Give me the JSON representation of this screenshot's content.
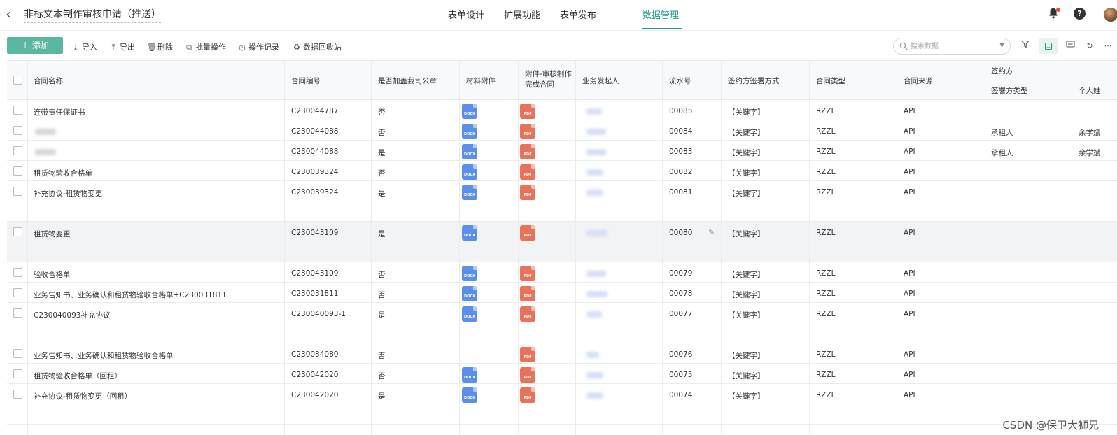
{
  "topbar": {
    "back_icon": "chevron-left-icon",
    "title": "非标文本制作审核申请（推送）",
    "tabs": [
      {
        "label": "表单设计"
      },
      {
        "label": "扩展功能"
      },
      {
        "label": "表单发布"
      },
      {
        "label": "数据管理",
        "active": true
      }
    ],
    "accent_color": "#1e9b8a"
  },
  "toolbar": {
    "add_label": "添加",
    "actions": [
      {
        "label": "导入",
        "icon": "import-icon"
      },
      {
        "label": "导出",
        "icon": "export-icon"
      },
      {
        "label": "删除",
        "icon": "trash-icon"
      },
      {
        "label": "批量操作",
        "icon": "batch-icon"
      },
      {
        "label": "操作记录",
        "icon": "history-icon"
      },
      {
        "label": "数据回收站",
        "icon": "recycle-icon"
      }
    ],
    "search_placeholder": "搜索数据",
    "add_color": "#5bb79f"
  },
  "table": {
    "columns": [
      {
        "label": "合同名称"
      },
      {
        "label": "合同编号"
      },
      {
        "label": "是否加盖我司公章"
      },
      {
        "label": "材料附件"
      },
      {
        "label": "附件-审核制作完成合同"
      },
      {
        "label": "业务发起人"
      },
      {
        "label": "流水号"
      },
      {
        "label": "签约方签署方式"
      },
      {
        "label": "合同类型"
      },
      {
        "label": "合同来源"
      }
    ],
    "group_header": "签约方",
    "sub_columns": [
      {
        "label": "签署方类型"
      },
      {
        "label": "个人姓"
      }
    ],
    "rows": [
      {
        "name": "连带责任保证书",
        "code": "C230044787",
        "seal": "否",
        "docx": true,
        "pdf": true,
        "serial": "00085",
        "method": "【关键字】",
        "type": "RZZL",
        "source": "API",
        "party_type": "",
        "person": ""
      },
      {
        "name": "",
        "code": "C230044088",
        "seal": "否",
        "docx": true,
        "pdf": true,
        "serial": "00084",
        "method": "【关键字】",
        "type": "RZZL",
        "source": "API",
        "party_type": "承租人",
        "person": "余学斌"
      },
      {
        "name": "",
        "code": "C230044088",
        "seal": "是",
        "docx": true,
        "pdf": true,
        "serial": "00083",
        "method": "【关键字】",
        "type": "RZZL",
        "source": "API",
        "party_type": "承租人",
        "person": "余学斌"
      },
      {
        "name": "租赁物验收合格单",
        "code": "C230039324",
        "seal": "否",
        "docx": true,
        "pdf": true,
        "serial": "00082",
        "method": "【关键字】",
        "type": "RZZL",
        "source": "API",
        "party_type": "",
        "person": ""
      },
      {
        "name": "补充协议-租赁物变更",
        "code": "C230039324",
        "seal": "是",
        "docx": true,
        "pdf": true,
        "serial": "00081",
        "method": "【关键字】",
        "type": "RZZL",
        "source": "API",
        "party_type": "",
        "person": ""
      },
      {
        "name": "租赁物变更",
        "code": "C230043109",
        "seal": "是",
        "docx": true,
        "pdf": true,
        "serial": "00080",
        "method": "【关键字】",
        "type": "RZZL",
        "source": "API",
        "party_type": "",
        "person": ""
      },
      {
        "name": "验收合格单",
        "code": "C230043109",
        "seal": "否",
        "docx": true,
        "pdf": true,
        "serial": "00079",
        "method": "【关键字】",
        "type": "RZZL",
        "source": "API",
        "party_type": "",
        "person": ""
      },
      {
        "name": "业务告知书、业务确认和租赁物验收合格单+C230031811",
        "code": "C230031811",
        "seal": "否",
        "docx": true,
        "pdf": true,
        "serial": "00078",
        "method": "【关键字】",
        "type": "RZZL",
        "source": "API",
        "party_type": "",
        "person": ""
      },
      {
        "name": "C230040093补充协议",
        "code": "C230040093-1",
        "seal": "是",
        "docx": true,
        "pdf": true,
        "serial": "00077",
        "method": "【关键字】",
        "type": "RZZL",
        "source": "API",
        "party_type": "",
        "person": ""
      },
      {
        "name": "业务告知书、业务确认和租赁物验收合格单",
        "code": "C230034080",
        "seal": "否",
        "docx": false,
        "pdf": true,
        "serial": "00076",
        "method": "【关键字】",
        "type": "RZZL",
        "source": "API",
        "party_type": "",
        "person": ""
      },
      {
        "name": "租赁物验收合格单（回租）",
        "code": "C230042020",
        "seal": "否",
        "docx": true,
        "pdf": true,
        "serial": "00075",
        "method": "【关键字】",
        "type": "RZZL",
        "source": "API",
        "party_type": "",
        "person": ""
      },
      {
        "name": "补充协议-租赁物变更（回租）",
        "code": "C230042020",
        "seal": "是",
        "docx": true,
        "pdf": true,
        "serial": "00074",
        "method": "【关键字】",
        "type": "RZZL",
        "source": "API",
        "party_type": "",
        "person": ""
      }
    ],
    "file_labels": {
      "docx": "DOCX",
      "pdf": "PDF"
    }
  },
  "watermark": "CSDN @保卫大狮兄"
}
